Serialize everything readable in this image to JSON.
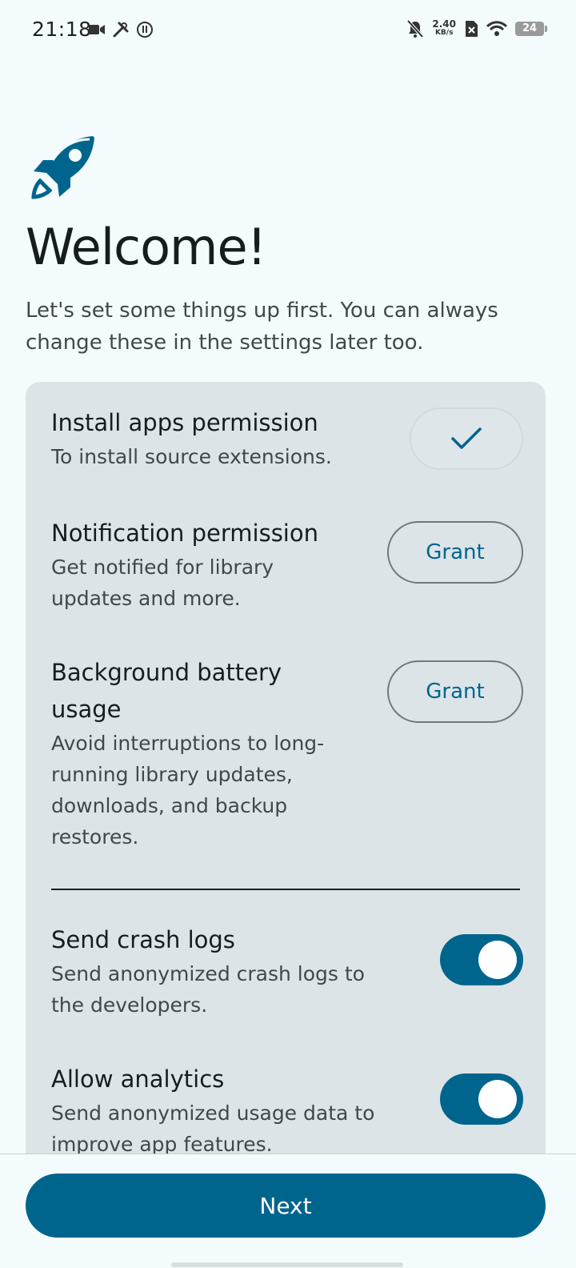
{
  "status_bar": {
    "time": "21:18",
    "net_speed_value": "2.40",
    "net_speed_unit": "KB/s",
    "battery": "24"
  },
  "welcome": {
    "title": "Welcome!",
    "subtitle": "Let's set some things up first. You can always change these in the settings later too."
  },
  "permissions": [
    {
      "title": "Install apps permission",
      "description": "To install source extensions.",
      "granted": true
    },
    {
      "title": "Notification permission",
      "description": "Get notified for library updates and more.",
      "button_label": "Grant",
      "granted": false
    },
    {
      "title": "Background battery usage",
      "description": "Avoid interruptions to long-running library updates, downloads, and backup restores.",
      "button_label": "Grant",
      "granted": false
    }
  ],
  "toggles": [
    {
      "title": "Send crash logs",
      "description": "Send anonymized crash logs to the developers.",
      "on": true
    },
    {
      "title": "Allow analytics",
      "description": "Send anonymized usage data to improve app features.",
      "on": true
    }
  ],
  "footer": {
    "next_label": "Next"
  },
  "colors": {
    "accent": "#00658d",
    "background": "#f3fbfd",
    "card": "#dce4e8"
  }
}
